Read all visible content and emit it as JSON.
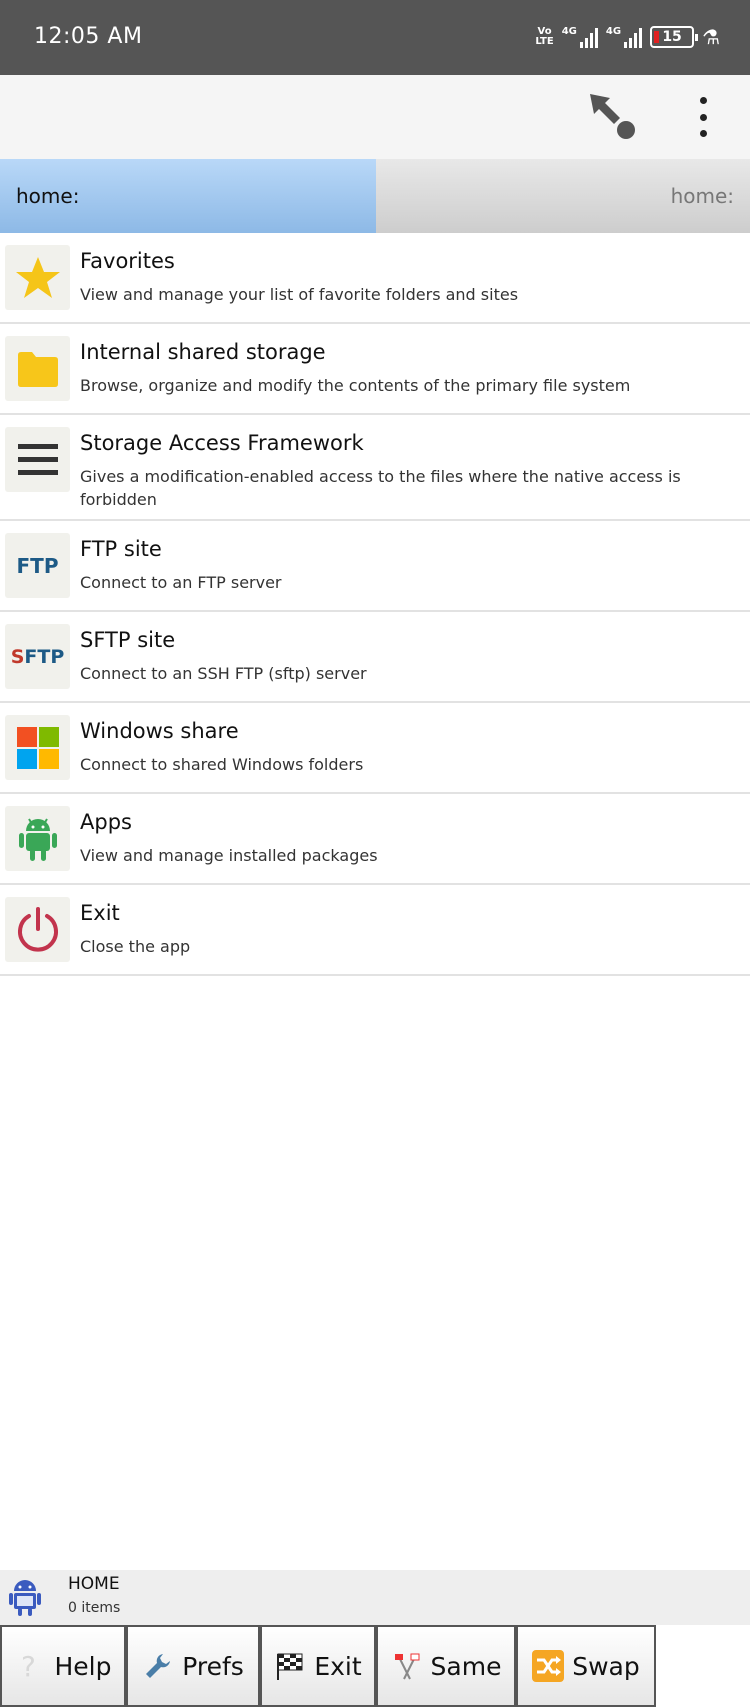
{
  "status_bar": {
    "time": "12:05 AM",
    "volte_top": "Vo",
    "volte_bottom": "LTE",
    "net1": "4G",
    "net2": "4G",
    "battery": "15"
  },
  "panels": {
    "left_path": "home:",
    "right_path": "home:"
  },
  "list": [
    {
      "title": "Favorites",
      "desc": "View and manage your list of favorite folders and sites",
      "icon": "star-icon"
    },
    {
      "title": "Internal shared storage",
      "desc": "Browse, organize and modify the contents of the primary file system",
      "icon": "folder-icon"
    },
    {
      "title": "Storage Access Framework",
      "desc": "Gives a modification-enabled access to the files where the native access is forbidden",
      "icon": "menu-lines-icon"
    },
    {
      "title": "FTP site",
      "desc": "Connect to an FTP server",
      "icon": "ftp-icon",
      "icon_text": "FTP"
    },
    {
      "title": "SFTP site",
      "desc": "Connect to an SSH FTP (sftp) server",
      "icon": "sftp-icon",
      "icon_text_a": "S",
      "icon_text_b": "FTP"
    },
    {
      "title": "Windows share",
      "desc": "Connect to shared Windows folders",
      "icon": "windows-icon"
    },
    {
      "title": "Apps",
      "desc": "View and manage installed packages",
      "icon": "android-icon"
    },
    {
      "title": "Exit",
      "desc": "Close the app",
      "icon": "power-icon"
    }
  ],
  "footer": {
    "location": "HOME",
    "items": "0 items"
  },
  "toolbar": {
    "help": "Help",
    "prefs": "Prefs",
    "exit": "Exit",
    "same": "Same",
    "swap": "Swap"
  },
  "colors": {
    "panel_active": "#a9ccf2",
    "star": "#f5c518",
    "folder": "#f7c61a",
    "power": "#c2344d",
    "android": "#3aa757"
  }
}
